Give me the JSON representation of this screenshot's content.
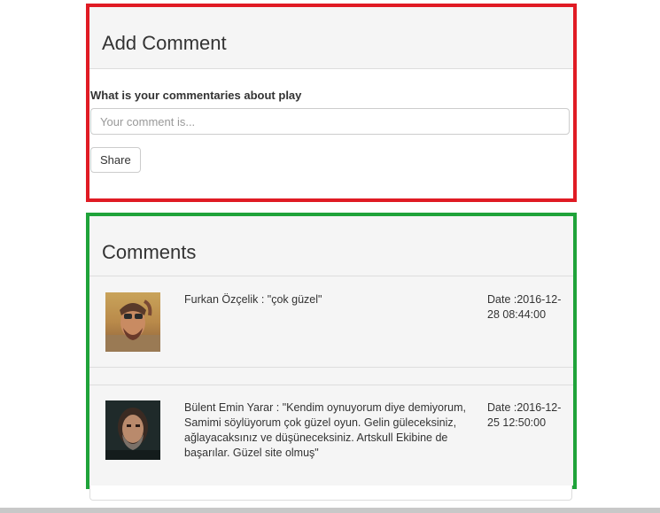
{
  "add_comment": {
    "title": "Add Comment",
    "question": "What is your commentaries about play",
    "input_placeholder": "Your comment is...",
    "input_value": "",
    "share_label": "Share",
    "frame_color": "#e01b24"
  },
  "comments": {
    "title": "Comments",
    "frame_color": "#1fa33a",
    "items": [
      {
        "text": "Furkan Özçelik : \"çok güzel\"",
        "date": "Date :2016-12-28 08:44:00",
        "avatar": "user-avatar-photo"
      },
      {
        "text": "Bülent Emin Yarar : \"Kendim oynuyorum diye demiyorum, Samimi söylüyorum çok güzel oyun. Gelin güleceksiniz, ağlayacaksınız ve düşüneceksiniz. Artskull Ekibine de başarılar. Güzel site olmuş\"",
        "date": "Date :2016-12-25 12:50:00",
        "avatar": "user-avatar-photo"
      }
    ]
  }
}
